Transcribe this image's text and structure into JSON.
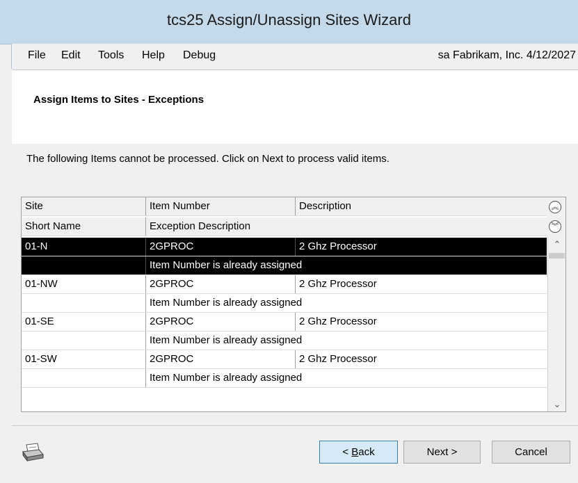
{
  "window": {
    "title": "tcs25 Assign/Unassign Sites Wizard"
  },
  "menu": {
    "items": [
      {
        "label": "File"
      },
      {
        "label": "Edit"
      },
      {
        "label": "Tools"
      },
      {
        "label": "Help"
      },
      {
        "label": "Debug"
      }
    ],
    "user": "sa",
    "company": "Fabrikam, Inc.",
    "date": "4/12/2027"
  },
  "header": {
    "title": "Assign Items to Sites - Exceptions"
  },
  "instruction": "The following Items cannot be processed. Click on Next to process valid items.",
  "grid": {
    "columns_row1": [
      "Site",
      "Item Number",
      "Description"
    ],
    "columns_row2": [
      "Short Name",
      "Exception Description"
    ],
    "rows": [
      {
        "site": "01-N",
        "item": "2GPROC",
        "description": "2 Ghz Processor",
        "exception": "Item Number is already assigned",
        "selected": true
      },
      {
        "site": "01-NW",
        "item": "2GPROC",
        "description": "2 Ghz Processor",
        "exception": "Item Number is already assigned",
        "selected": false
      },
      {
        "site": "01-SE",
        "item": "2GPROC",
        "description": "2 Ghz Processor",
        "exception": "Item Number is already assigned",
        "selected": false
      },
      {
        "site": "01-SW",
        "item": "2GPROC",
        "description": "2 Ghz Processor",
        "exception": "Item Number is already assigned",
        "selected": false
      }
    ]
  },
  "buttons": {
    "back_prefix": "< ",
    "back_mnemonic": "B",
    "back_rest": "ack",
    "next": "Next >",
    "cancel": "Cancel"
  }
}
